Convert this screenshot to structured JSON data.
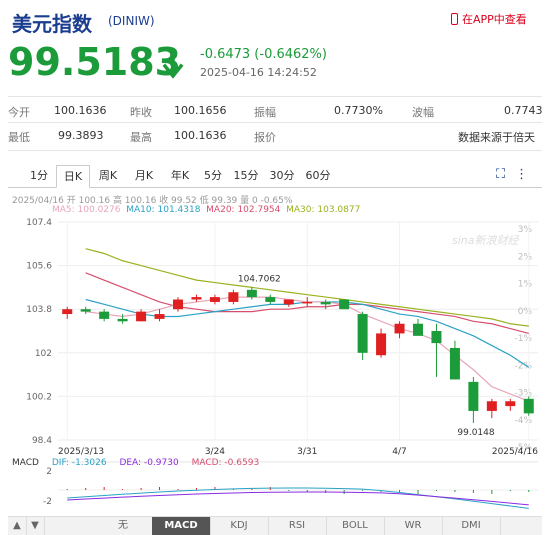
{
  "header": {
    "title": "美元指数",
    "code": "(DINIW)",
    "app_link": "在APP中查看"
  },
  "quote": {
    "price": "99.5183",
    "change": "-0.6473 (-0.6462%)",
    "datetime": "2025-04-16 14:24:52"
  },
  "stats": {
    "open_label": "今开",
    "open": "100.1636",
    "prev_close_label": "昨收",
    "prev_close": "100.1656",
    "amplitude_label": "振幅",
    "amplitude": "0.7730%",
    "range_label": "波幅",
    "range": "0.7743",
    "low_label": "最低",
    "low": "99.3893",
    "high_label": "最高",
    "high": "100.1636",
    "quote_label": "报价",
    "source": "数据来源于倍天"
  },
  "tabs": [
    "1分",
    "日K",
    "周K",
    "月K",
    "年K",
    "5分",
    "15分",
    "30分",
    "60分"
  ],
  "active_tab": "日K",
  "chart_info": "2025/04/16 开 100.16 高 100.16 收 99.52 低 99.39 量 0 -0.65%",
  "ma": {
    "ma5": "MA5: 100.0276",
    "ma10": "MA10: 101.4318",
    "ma20": "MA20: 102.7954",
    "ma30": "MA30: 103.0877"
  },
  "colors": {
    "up": "#e02020",
    "down": "#1c9b3a",
    "ma5": "#e8a6b8",
    "ma10": "#2aa2c7",
    "ma20": "#d64f6e",
    "ma30": "#99b21e"
  },
  "watermark": "sina新浪财经",
  "chart_data": {
    "type": "candlestick",
    "y_ticks": [
      "107.4",
      "105.6",
      "103.8",
      "102",
      "100.2",
      "98.4"
    ],
    "y_range": [
      98.4,
      107.4
    ],
    "pct_ticks": [
      "3%",
      "2%",
      "1%",
      "0%",
      "-1%",
      "-2%",
      "-3%",
      "-4%",
      "-5%"
    ],
    "x_labels": [
      "2025/3/13",
      "3/24",
      "3/31",
      "4/7",
      "2025/4/16"
    ],
    "high_annotation": "104.7062",
    "low_annotation": "99.0148",
    "candles": [
      {
        "o": 103.6,
        "h": 103.9,
        "l": 103.4,
        "c": 103.8
      },
      {
        "o": 103.8,
        "h": 103.9,
        "l": 103.6,
        "c": 103.7
      },
      {
        "o": 103.7,
        "h": 103.8,
        "l": 103.3,
        "c": 103.4
      },
      {
        "o": 103.4,
        "h": 103.6,
        "l": 103.2,
        "c": 103.3
      },
      {
        "o": 103.3,
        "h": 103.8,
        "l": 103.3,
        "c": 103.7
      },
      {
        "o": 103.4,
        "h": 103.8,
        "l": 103.3,
        "c": 103.6
      },
      {
        "o": 103.8,
        "h": 104.3,
        "l": 103.7,
        "c": 104.2
      },
      {
        "o": 104.2,
        "h": 104.4,
        "l": 104.1,
        "c": 104.3
      },
      {
        "o": 104.1,
        "h": 104.4,
        "l": 104.0,
        "c": 104.3
      },
      {
        "o": 104.1,
        "h": 104.6,
        "l": 104.0,
        "c": 104.5
      },
      {
        "o": 104.6,
        "h": 104.7,
        "l": 104.2,
        "c": 104.3
      },
      {
        "o": 104.3,
        "h": 104.4,
        "l": 104.0,
        "c": 104.1
      },
      {
        "o": 104.0,
        "h": 104.2,
        "l": 103.9,
        "c": 104.2
      },
      {
        "o": 104.1,
        "h": 104.3,
        "l": 103.9,
        "c": 104.1
      },
      {
        "o": 104.1,
        "h": 104.2,
        "l": 103.8,
        "c": 104.0
      },
      {
        "o": 104.2,
        "h": 104.2,
        "l": 103.8,
        "c": 103.8
      },
      {
        "o": 103.6,
        "h": 103.7,
        "l": 101.7,
        "c": 102.0
      },
      {
        "o": 101.9,
        "h": 103.0,
        "l": 101.8,
        "c": 102.8
      },
      {
        "o": 102.8,
        "h": 103.3,
        "l": 102.6,
        "c": 103.2
      },
      {
        "o": 103.2,
        "h": 103.4,
        "l": 102.8,
        "c": 102.7
      },
      {
        "o": 102.9,
        "h": 103.2,
        "l": 101.0,
        "c": 102.4
      },
      {
        "o": 102.2,
        "h": 102.5,
        "l": 100.9,
        "c": 100.9
      },
      {
        "o": 100.8,
        "h": 101.0,
        "l": 99.1,
        "c": 99.6
      },
      {
        "o": 99.6,
        "h": 100.1,
        "l": 99.3,
        "c": 100.0
      },
      {
        "o": 99.8,
        "h": 100.1,
        "l": 99.6,
        "c": 100.0
      },
      {
        "o": 100.1,
        "h": 100.2,
        "l": 99.4,
        "c": 99.5
      }
    ],
    "ma5": [
      103.7,
      103.6,
      103.5,
      103.6,
      103.8,
      104.0,
      104.1,
      104.2,
      104.3,
      104.3,
      104.3,
      104.2,
      104.1,
      104.1,
      104.0,
      103.6,
      103.3,
      103.0,
      102.8,
      102.5,
      101.9,
      101.3,
      100.6,
      100.3,
      100.0
    ],
    "ma10": [
      104.2,
      104.0,
      103.8,
      103.6,
      103.5,
      103.5,
      103.6,
      103.7,
      103.8,
      103.9,
      104.0,
      104.0,
      104.1,
      104.1,
      104.1,
      104.0,
      103.8,
      103.6,
      103.5,
      103.3,
      103.0,
      102.7,
      102.3,
      101.9,
      101.4
    ],
    "ma20": [
      105.3,
      105.0,
      104.7,
      104.4,
      104.1,
      103.9,
      103.8,
      103.7,
      103.7,
      103.7,
      103.8,
      103.8,
      103.9,
      103.9,
      104.0,
      104.0,
      103.9,
      103.8,
      103.7,
      103.6,
      103.5,
      103.3,
      103.2,
      103.0,
      102.8
    ],
    "ma30": [
      106.3,
      106.1,
      105.8,
      105.6,
      105.4,
      105.2,
      105.0,
      104.9,
      104.8,
      104.7,
      104.6,
      104.5,
      104.4,
      104.3,
      104.2,
      104.1,
      104.0,
      103.9,
      103.8,
      103.7,
      103.6,
      103.5,
      103.4,
      103.2,
      103.1
    ],
    "macd_legend": {
      "label": "MACD",
      "dif": "DIF: -1.3026",
      "dea": "DEA: -0.9730",
      "macd": "MACD: -0.6593"
    },
    "macd_ticks": [
      "2",
      "-2"
    ]
  },
  "indicator_tabs": [
    "无",
    "MACD",
    "KDJ",
    "RSI",
    "BOLL",
    "WR",
    "DMI"
  ],
  "active_indicator": "MACD",
  "nav_arrows": [
    "▲",
    "▼"
  ]
}
